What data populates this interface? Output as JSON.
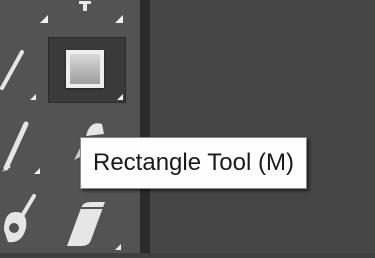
{
  "tooltip": {
    "text": "Rectangle Tool (M)"
  },
  "toolbar": {
    "active_tool": "rectangle-tool",
    "tools": [
      "line-segment-tool",
      "rectangle-tool",
      "paintbrush-tool",
      "shaper-tool",
      "blob-brush-tool",
      "eraser-tool"
    ]
  },
  "colors": {
    "toolbar_bg": "#535353",
    "canvas_bg": "#454545",
    "tooltip_bg": "#fefefe",
    "active_tool_bg": "#3a3a3a"
  }
}
